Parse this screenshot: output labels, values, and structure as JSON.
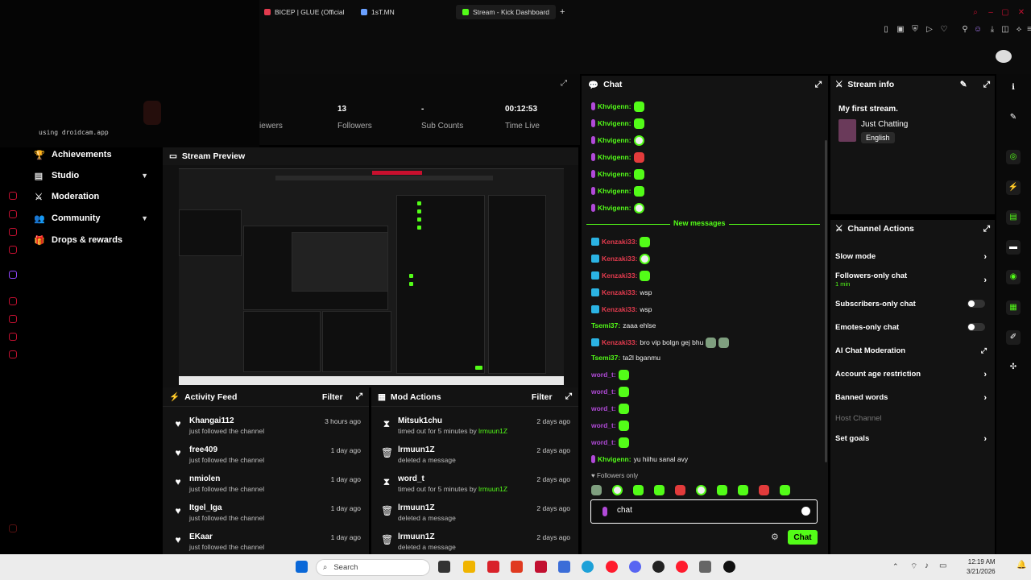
{
  "browser": {
    "tabs": [
      {
        "label": "BICEP | GLUE (Official"
      },
      {
        "label": "1sT.MN"
      },
      {
        "label": "Stream - Kick Dashboard"
      }
    ],
    "new_tab": "+"
  },
  "webcam": {
    "overlay_text": "using droidcam.app"
  },
  "left_nav": {
    "items": [
      {
        "label": "Achievements",
        "icon": "trophy-icon"
      },
      {
        "label": "Studio",
        "icon": "clapper-icon"
      },
      {
        "label": "Moderation",
        "icon": "sword-icon"
      },
      {
        "label": "Community",
        "icon": "people-icon"
      },
      {
        "label": "Drops & rewards",
        "icon": "gift-icon"
      }
    ]
  },
  "stats": {
    "viewers_label": "iewers",
    "followers": {
      "value": "13",
      "label": "Followers"
    },
    "subs": {
      "value": "-",
      "label": "Sub Counts"
    },
    "time": {
      "value": "00:12:53",
      "label": "Time Live"
    }
  },
  "preview": {
    "title": "Stream Preview"
  },
  "activity_feed": {
    "title": "Activity Feed",
    "filter": "Filter",
    "rows": [
      {
        "name": "Khangai112",
        "desc": "just followed the channel",
        "time": "3 hours ago"
      },
      {
        "name": "free409",
        "desc": "just followed the channel",
        "time": "1 day ago"
      },
      {
        "name": "nmiolen",
        "desc": "just followed the channel",
        "time": "1 day ago"
      },
      {
        "name": "Itgel_Iga",
        "desc": "just followed the channel",
        "time": "1 day ago"
      },
      {
        "name": "EKaar",
        "desc": "just followed the channel",
        "time": "1 day ago"
      }
    ]
  },
  "mod_actions": {
    "title": "Mod Actions",
    "filter": "Filter",
    "rows": [
      {
        "name": "Mitsuk1chu",
        "desc": "timed out for 5 minutes by",
        "by": "lrmuun1Z",
        "time": "2 days ago",
        "icon": "hourglass-icon"
      },
      {
        "name": "lrmuun1Z",
        "desc": "deleted a message",
        "by": "",
        "time": "2 days ago",
        "icon": "trash-icon"
      },
      {
        "name": "word_t",
        "desc": "timed out for 5 minutes by",
        "by": "lrmuun1Z",
        "time": "2 days ago",
        "icon": "hourglass-icon"
      },
      {
        "name": "lrmuun1Z",
        "desc": "deleted a message",
        "by": "",
        "time": "2 days ago",
        "icon": "trash-icon"
      },
      {
        "name": "lrmuun1Z",
        "desc": "deleted a message",
        "by": "",
        "time": "2 days ago",
        "icon": "trash-icon"
      }
    ]
  },
  "chat": {
    "title": "Chat",
    "new_messages": "New messages",
    "messages": [
      {
        "user": "Khvigenn:",
        "text": "",
        "badge": "mic",
        "color": "#53fc18",
        "emote": "green"
      },
      {
        "user": "Khvigenn:",
        "text": "",
        "badge": "mic",
        "color": "#53fc18",
        "emote": "green"
      },
      {
        "user": "Khvigenn:",
        "text": "",
        "badge": "mic",
        "color": "#53fc18",
        "emote": "white"
      },
      {
        "user": "Khvigenn:",
        "text": "",
        "badge": "mic",
        "color": "#53fc18",
        "emote": "red"
      },
      {
        "user": "Khvigenn:",
        "text": "",
        "badge": "mic",
        "color": "#53fc18",
        "emote": "green"
      },
      {
        "user": "Khvigenn:",
        "text": "",
        "badge": "mic",
        "color": "#53fc18",
        "emote": "green"
      },
      {
        "user": "Khvigenn:",
        "text": "",
        "badge": "mic",
        "color": "#53fc18",
        "emote": "white"
      },
      {
        "user": "Kenzaki33:",
        "text": "",
        "badge": "sword",
        "color": "#e33b4e",
        "emote": "green"
      },
      {
        "user": "Kenzaki33:",
        "text": "",
        "badge": "sword",
        "color": "#e33b4e",
        "emote": "white"
      },
      {
        "user": "Kenzaki33:",
        "text": "",
        "badge": "sword",
        "color": "#e33b4e",
        "emote": "green"
      },
      {
        "user": "Kenzaki33:",
        "text": "wsp",
        "badge": "sword",
        "color": "#e33b4e",
        "emote": ""
      },
      {
        "user": "Kenzaki33:",
        "text": "wsp",
        "badge": "sword",
        "color": "#e33b4e",
        "emote": ""
      },
      {
        "user": "Tsemi37:",
        "text": "zaaa ehlse",
        "badge": "",
        "color": "#53fc18",
        "emote": ""
      },
      {
        "user": "Kenzaki33:",
        "text": "bro vip bolgn gej bhu",
        "badge": "sword",
        "color": "#e33b4e",
        "emote": "gray2"
      },
      {
        "user": "Tsemi37:",
        "text": "ta2l bganmu",
        "badge": "",
        "color": "#53fc18",
        "emote": ""
      },
      {
        "user": "word_t:",
        "text": "",
        "badge": "",
        "color": "#b14ad8",
        "emote": "green"
      },
      {
        "user": "word_t:",
        "text": "",
        "badge": "",
        "color": "#b14ad8",
        "emote": "green"
      },
      {
        "user": "word_t:",
        "text": "",
        "badge": "",
        "color": "#b14ad8",
        "emote": "green"
      },
      {
        "user": "word_t:",
        "text": "",
        "badge": "",
        "color": "#b14ad8",
        "emote": "green"
      },
      {
        "user": "word_t:",
        "text": "",
        "badge": "",
        "color": "#b14ad8",
        "emote": "green"
      },
      {
        "user": "Khvigenn:",
        "text": "yu hiihu sanal avy",
        "badge": "mic",
        "color": "#53fc18",
        "emote": ""
      }
    ],
    "followers_only": "Followers only",
    "input_value": "chat",
    "send_label": "Chat"
  },
  "stream_info": {
    "title": "Stream info",
    "stream_title": "My first stream.",
    "category": "Just Chatting",
    "language": "English"
  },
  "channel_actions": {
    "title": "Channel Actions",
    "items": [
      {
        "label": "Slow mode",
        "control": "chevron"
      },
      {
        "label": "Followers-only chat",
        "sub": "1 min",
        "control": "chevron"
      },
      {
        "label": "Subscribers-only chat",
        "control": "toggle"
      },
      {
        "label": "Emotes-only chat",
        "control": "toggle"
      },
      {
        "label": "AI Chat Moderation",
        "control": "external"
      },
      {
        "label": "Account age restriction",
        "control": "chevron"
      },
      {
        "label": "Banned words",
        "control": "chevron"
      },
      {
        "label": "Host Channel",
        "control": "none"
      },
      {
        "label": "Set goals",
        "control": "chevron"
      }
    ]
  },
  "taskbar": {
    "search_placeholder": "Search",
    "time": "12:19 AM",
    "date": "3/21/2026"
  },
  "colors": {
    "accent": "#53fc18",
    "kick_red": "#e33b4e",
    "purple": "#b14ad8"
  }
}
